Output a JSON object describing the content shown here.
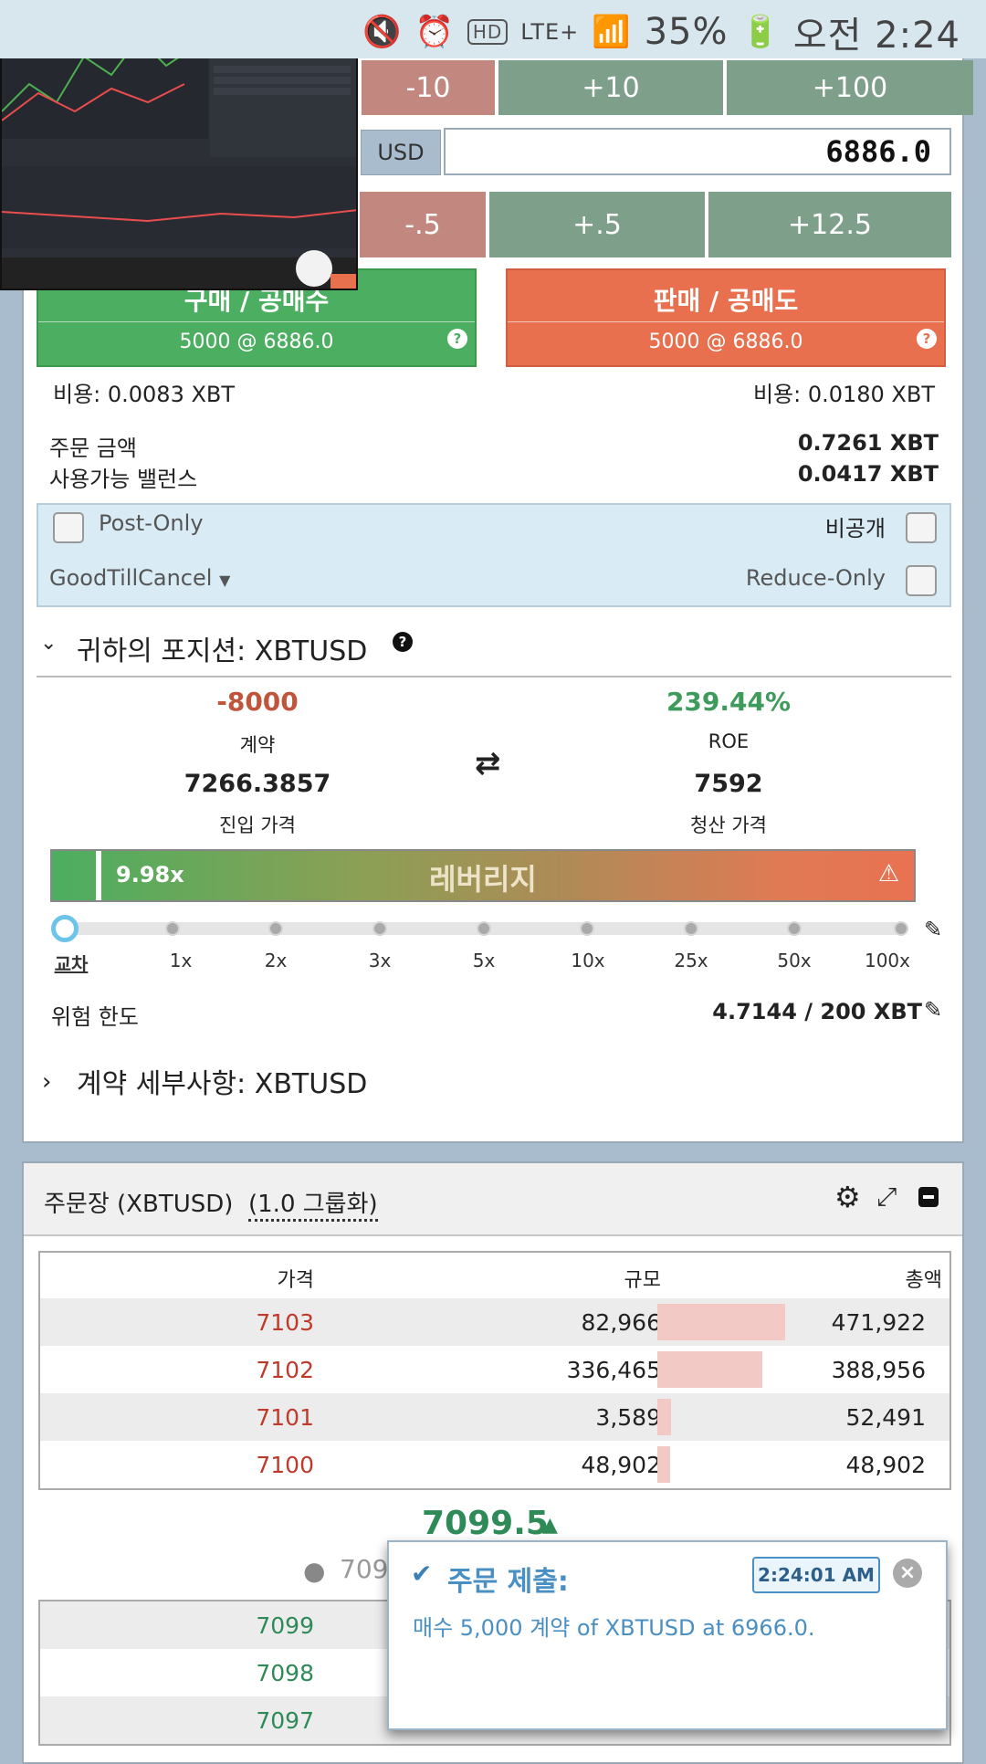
{
  "status_bar": {
    "battery": "35%",
    "time": "오전 2:24",
    "network": "LTE+"
  },
  "qty_buttons": {
    "minus10": "-10",
    "plus10": "+10",
    "plus100": "+100"
  },
  "price": {
    "currency": "USD",
    "value": "6886.0"
  },
  "price_buttons": {
    "minus05": "-.5",
    "plus05": "+.5",
    "plus125": "+12.5"
  },
  "buy": {
    "label": "구매 / 공매수",
    "order": "5000 @ 6886.0",
    "fee": "비용: 0.0083 XBT"
  },
  "sell": {
    "label": "판매 / 공매도",
    "order": "5000 @ 6886.0",
    "fee": "비용: 0.0180 XBT"
  },
  "order_value": {
    "label": "주문 금액",
    "value": "0.7261 XBT"
  },
  "available": {
    "label": "사용가능 밸런스",
    "value": "0.0417 XBT"
  },
  "options": {
    "post_only": "Post-Only",
    "hidden": "비공개",
    "tif": "GoodTillCancel",
    "reduce_only": "Reduce-Only"
  },
  "position": {
    "title": "귀하의 포지션: XBTUSD",
    "contracts": "-8000",
    "contracts_label": "계약",
    "roe": "239.44%",
    "roe_label": "ROE",
    "entry": "7266.3857",
    "entry_label": "진입 가격",
    "liq": "7592",
    "liq_label": "청산 가격",
    "leverage": "9.98x",
    "leverage_label": "레버리지"
  },
  "leverage_ticks": [
    "교차",
    "1x",
    "2x",
    "3x",
    "5x",
    "10x",
    "25x",
    "50x",
    "100x"
  ],
  "risk": {
    "label": "위험 한도",
    "value": "4.7144 / 200 XBT"
  },
  "contract_details": "계약 세부사항: XBTUSD",
  "orderbook": {
    "title": "주문장 (XBTUSD)",
    "grouping": "(1.0 그룹화)",
    "headers": {
      "price": "가격",
      "size": "규모",
      "total": "총액"
    },
    "asks": [
      {
        "price": "7103",
        "size": "82,966",
        "total": "471,922",
        "bar": 1.0
      },
      {
        "price": "7102",
        "size": "336,465",
        "total": "388,956",
        "bar": 0.82
      },
      {
        "price": "7101",
        "size": "3,589",
        "total": "52,491",
        "bar": 0.11
      },
      {
        "price": "7100",
        "size": "48,902",
        "total": "48,902",
        "bar": 0.1
      }
    ],
    "last_price": "7099.5",
    "index_price": "709",
    "bids": [
      {
        "price": "7099"
      },
      {
        "price": "7098"
      },
      {
        "price": "7097"
      }
    ]
  },
  "toast": {
    "title": "주문 제출:",
    "time": "2:24:01 AM",
    "message": "매수 5,000 계약 of XBTUSD at 6966.0."
  },
  "colors": {
    "buy": "#4cae60",
    "sell": "#e8704f",
    "ask_text": "#c0392b",
    "bid_text": "#2e8b57"
  }
}
